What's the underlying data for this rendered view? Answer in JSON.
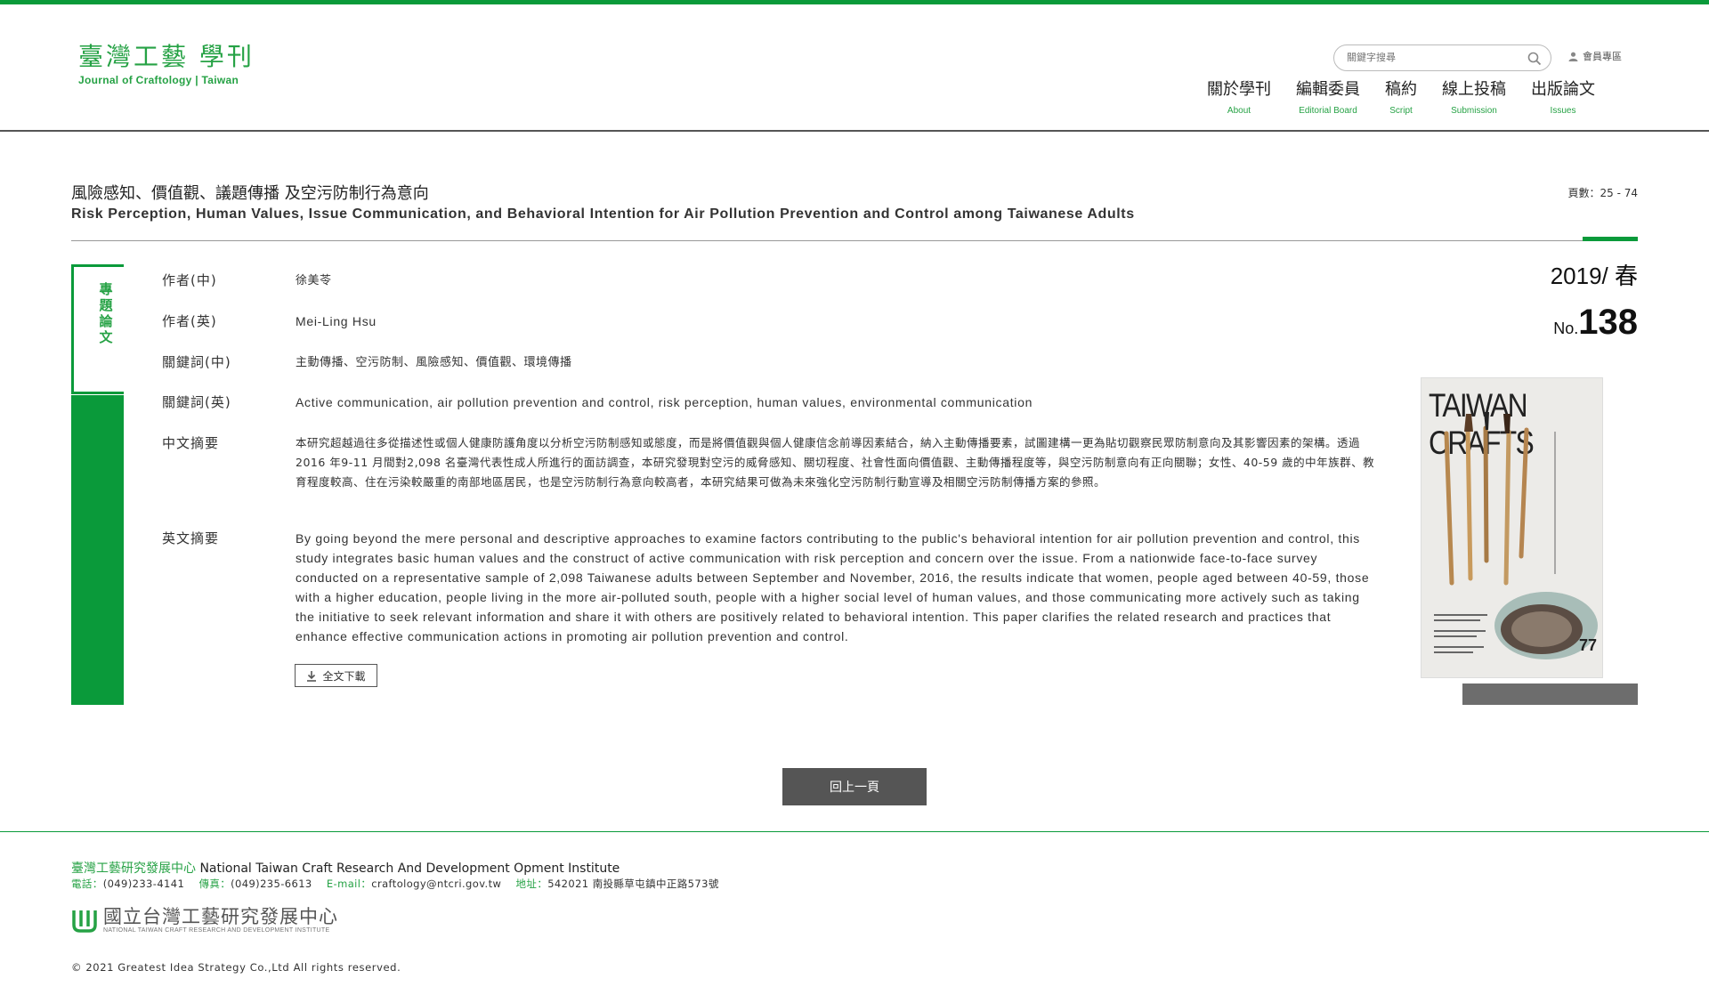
{
  "header": {
    "logo_zh": "臺灣工藝 學刊",
    "logo_en": "Journal of Craftology | Taiwan",
    "search_placeholder": "關鍵字搜尋",
    "member_label": "會員專區",
    "nav": [
      {
        "zh": "關於學刊",
        "en": "About"
      },
      {
        "zh": "編輯委員",
        "en": "Editorial Board"
      },
      {
        "zh": "稿約",
        "en": "Script"
      },
      {
        "zh": "線上投稿",
        "en": "Submission"
      },
      {
        "zh": "出版論文",
        "en": "Issues"
      }
    ]
  },
  "article": {
    "title_zh": "風險感知、價值觀、議題傳播 及空污防制行為意向",
    "title_en": "Risk Perception, Human Values, Issue Communication, and Behavioral Intention for Air Pollution Prevention and Control among Taiwanese Adults",
    "pages": "頁數：25 - 74",
    "category": "專題論文",
    "rows": [
      {
        "label": "作者(中)",
        "value": "徐美苓"
      },
      {
        "label": "作者(英)",
        "value": "Mei-Ling Hsu"
      },
      {
        "label": "關鍵詞(中)",
        "value": "主動傳播、空污防制、風險感知、價值觀、環境傳播"
      },
      {
        "label": "關鍵詞(英)",
        "value": "Active communication, air pollution prevention and control, risk perception, human values, environmental communication"
      },
      {
        "label": "中文摘要",
        "value": "本研究超越過往多從描述性或個人健康防護角度以分析空污防制感知或態度，而是將價值觀與個人健康信念前導因素結合，納入主動傳播要素，試圖建構一更為貼切觀察民眾防制意向及其影響因素的架構。透過2016 年9-11 月間對2,098 名臺灣代表性成人所進行的面訪調查，本研究發現對空污的威脅感知、關切程度、社會性面向價值觀、主動傳播程度等，與空污防制意向有正向關聯；女性、40-59 歲的中年族群、教育程度較高、住在污染較嚴重的南部地區居民，也是空污防制行為意向較高者，本研究結果可做為未來強化空污防制行動宣導及相關空污防制傳播方案的參照。"
      },
      {
        "label": "英文摘要",
        "value": "By going beyond the mere personal and descriptive approaches to examine factors contributing to the public's behavioral intention for air pollution prevention and control, this study integrates basic human values and the construct of active communication with risk perception and concern over the issue. From a nationwide face-to-face survey conducted on a representative sample of 2,098 Taiwanese adults between September and November, 2016, the results indicate that women, people aged between 40-59, those with a higher education, people living in the more air-polluted south, people with a higher social level of human values, and those communicating more actively such as taking the initiative to seek relevant information and share it with others are positively related to behavioral intention. This paper clarifies the related research and practices that enhance effective communication actions in promoting air pollution prevention and control."
      }
    ],
    "download_label": "全文下載",
    "season": "2019/ 春",
    "issue_prefix": "No.",
    "issue_number": "138",
    "cover_title": "TAIWAN CRAFTS",
    "cover_number": "77",
    "back_label": "回上一頁"
  },
  "footer": {
    "inst_zh": "臺灣工藝研究發展中心",
    "inst_en": "National Taiwan Craft Research And Development Opment Institute",
    "tel_label": "電話：",
    "tel": "(049)233-4141",
    "fax_label": "傳真：",
    "fax": "(049)235-6613",
    "email_label": "E-mail：",
    "email": "craftology@ntcri.gov.tw",
    "addr_label": "地址：",
    "addr": "542021 南投縣草屯鎮中正路573號",
    "logo_zh": "國立台灣工藝研究發展中心",
    "logo_en": "NATIONAL TAIWAN CRAFT RESEARCH AND DEVELOPMENT INSTITUTE",
    "copyright": "© 2021 Greatest Idea Strategy Co.,Ltd All rights reserved."
  },
  "colors": {
    "accent": "#0a9a3a",
    "accent_text": "#26a245",
    "button": "#555555"
  }
}
